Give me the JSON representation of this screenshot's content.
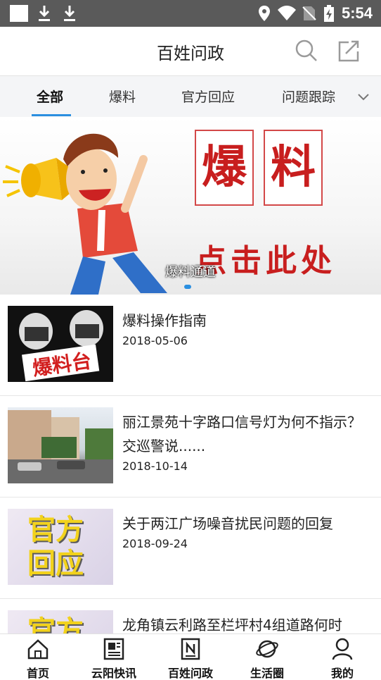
{
  "status_bar": {
    "time": "5:54",
    "icons": [
      "notification-square-icon",
      "download-icon",
      "download-icon",
      "location-icon",
      "wifi-icon",
      "no-sim-icon",
      "battery-charging-icon"
    ]
  },
  "header": {
    "title": "百姓问政",
    "icons": [
      "search-icon",
      "share-icon"
    ]
  },
  "tabs": {
    "items": [
      {
        "label": "全部",
        "active": true
      },
      {
        "label": "爆料",
        "active": false
      },
      {
        "label": "官方回应",
        "active": false
      },
      {
        "label": "问题跟踪",
        "active": false
      }
    ],
    "expand_icon": "chevron-down-icon"
  },
  "banner": {
    "caption": "爆料通道",
    "char1": "爆",
    "char2": "料",
    "cta": "点击此处"
  },
  "news": [
    {
      "title": "爆料操作指南",
      "date": "2018-05-06",
      "thumb_text": "爆料台"
    },
    {
      "title": "丽江景苑十字路口信号灯为何不指示？交巡警说......",
      "date": "2018-10-14"
    },
    {
      "title": "关于两江广场噪音扰民问题的回复",
      "date": "2018-09-24",
      "thumb_text": "官方回应"
    },
    {
      "title": "龙角镇云利路至栏坪村4组道路何时",
      "thumb_text": "官方"
    }
  ],
  "bottom_nav": [
    {
      "label": "首页",
      "icon": "home-icon"
    },
    {
      "label": "云阳快讯",
      "icon": "newspaper-icon"
    },
    {
      "label": "百姓问政",
      "icon": "document-n-icon"
    },
    {
      "label": "生活圈",
      "icon": "planet-icon"
    },
    {
      "label": "我的",
      "icon": "user-icon"
    }
  ],
  "colors": {
    "accent": "#2b8fe0",
    "status_bar": "#5a5a5a",
    "banner_red": "#c81e1e"
  }
}
